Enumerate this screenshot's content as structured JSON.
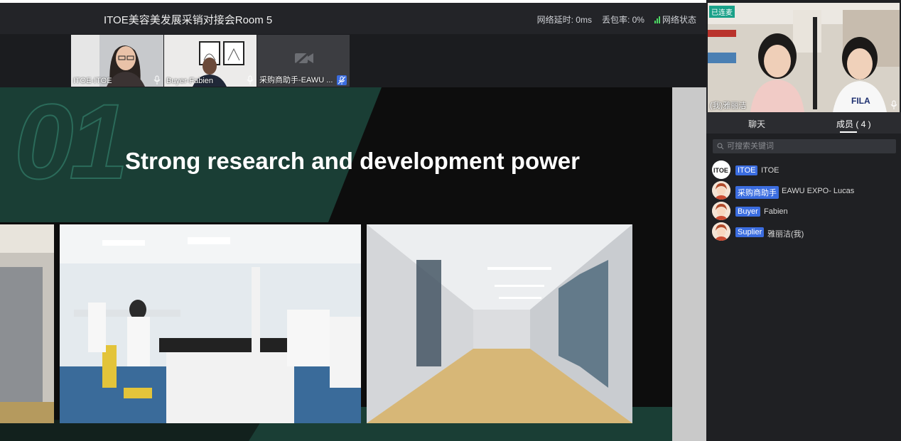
{
  "meeting": {
    "title": "ITOE美容美发展采销对接会Room 5",
    "latency": "网络延时: 0ms",
    "packet_loss": "丢包率: 0%",
    "network_status": "网络状态",
    "signal_color": "#4cd964"
  },
  "participants_strip": [
    {
      "name": "ITOE-ITOE",
      "mic_icon": "mic-icon",
      "video": "on"
    },
    {
      "name": "Buyer-Fabien",
      "mic_icon": "mic-icon",
      "video": "on"
    },
    {
      "name": "采购商助手-EAWU ...",
      "mic_icon": "mic-muted-icon",
      "video": "off"
    }
  ],
  "slide": {
    "number_watermark": "01",
    "title": "Strong research and development power",
    "accent_color": "#1a3e35"
  },
  "self_view": {
    "status_badge": "已连麦",
    "name": "(我)雅丽洁",
    "badge_color": "#1aa189"
  },
  "panel": {
    "tabs": [
      {
        "label": "聊天",
        "active": false
      },
      {
        "label": "成员 ( 4 )",
        "active": true
      }
    ],
    "search_placeholder": "可搜索关键词",
    "members": [
      {
        "role": "ITOE",
        "name": "ITOE",
        "avatar": "itoe-logo"
      },
      {
        "role": "采购商助手",
        "name": "EAWU EXPO- Lucas",
        "avatar": "person-avatar"
      },
      {
        "role": "Buyer",
        "name": "Fabien",
        "avatar": "person-avatar"
      },
      {
        "role": "Suplier",
        "name": "雅丽洁(我)",
        "avatar": "person-avatar"
      }
    ],
    "role_color": "#3b6de0"
  }
}
